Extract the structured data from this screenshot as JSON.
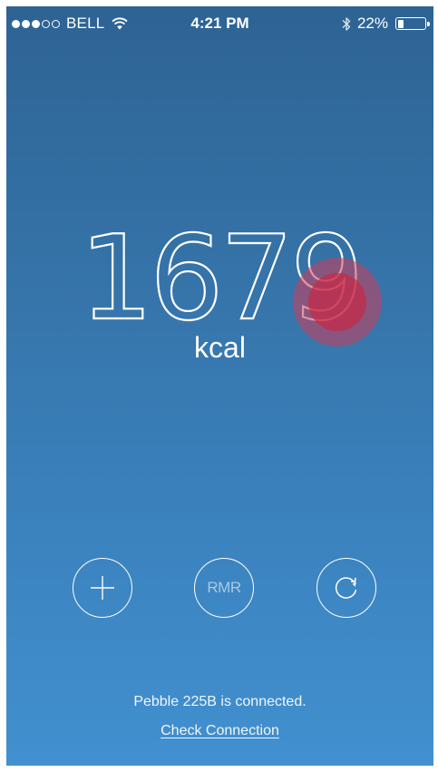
{
  "status_bar": {
    "signal_full": 3,
    "signal_total": 5,
    "carrier": "BELL",
    "time": "4:21 PM",
    "battery_percent": "22%",
    "battery_level": 0.22,
    "icons": [
      "signal-dots-icon",
      "wifi-icon",
      "bluetooth-icon",
      "battery-icon"
    ]
  },
  "main": {
    "value": "1679",
    "unit": "kcal"
  },
  "actions": {
    "add_icon": "plus-icon",
    "rmr_label": "RMR",
    "reset_icon": "refresh-icon"
  },
  "footer": {
    "connection_status": "Pebble 225B is connected.",
    "check_connection": "Check Connection"
  },
  "colors": {
    "background_top": "#2e6394",
    "background_bottom": "#4290d0",
    "foreground": "#ffffff",
    "touch_indicator": "#c8284a"
  }
}
